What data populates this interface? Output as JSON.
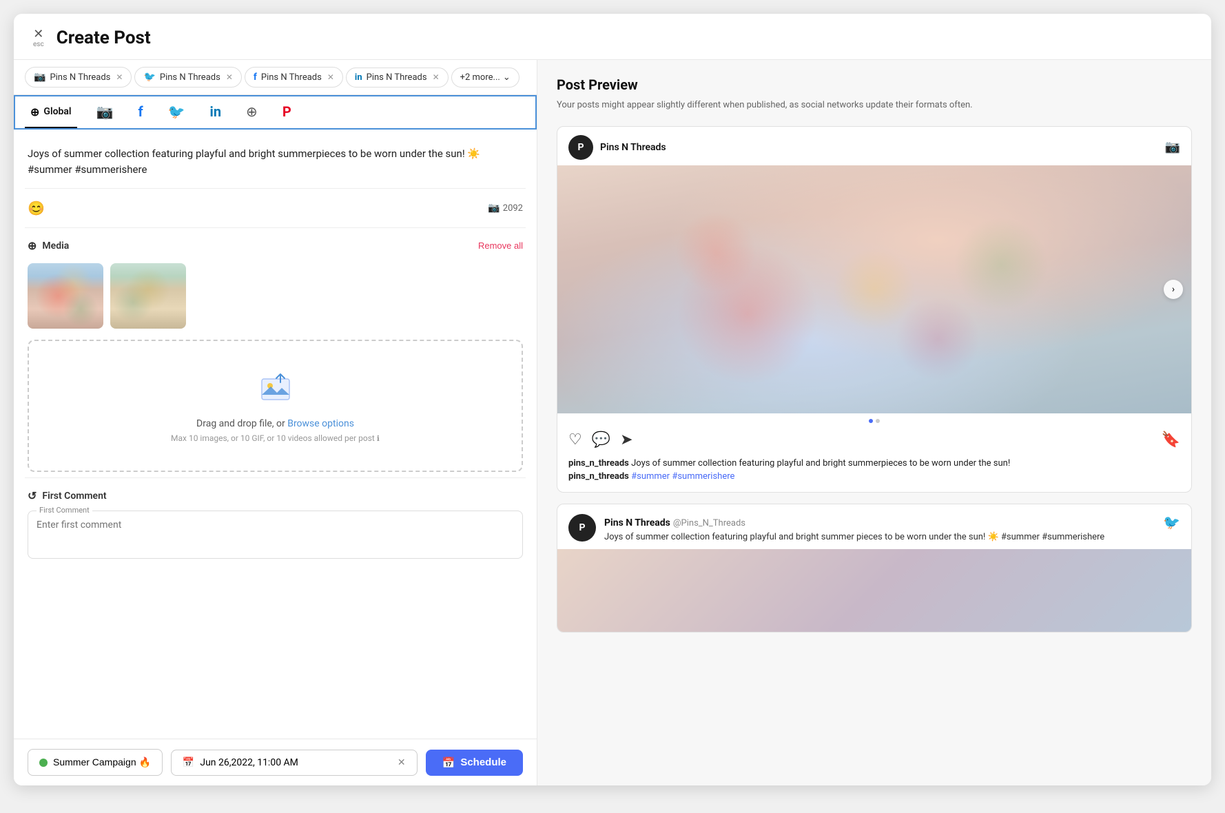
{
  "modal": {
    "title": "Create Post",
    "close_label": "×",
    "esc_label": "esc"
  },
  "tabs": [
    {
      "id": "tab-ig-1",
      "platform": "instagram",
      "label": "Pins N Threads",
      "symbol": "📷"
    },
    {
      "id": "tab-tw-1",
      "platform": "twitter",
      "label": "Pins N Threads",
      "symbol": "🐦"
    },
    {
      "id": "tab-fb-1",
      "platform": "facebook",
      "label": "Pins N Threads",
      "symbol": "f"
    },
    {
      "id": "tab-li-1",
      "platform": "linkedin",
      "label": "Pins N Threads",
      "symbol": "in"
    },
    {
      "id": "tab-more",
      "platform": "more",
      "label": "+2 more...",
      "symbol": ""
    }
  ],
  "platform_tabs": [
    {
      "id": "global",
      "label": "Global",
      "active": true
    },
    {
      "id": "instagram",
      "label": "",
      "platform": "instagram"
    },
    {
      "id": "facebook",
      "label": "",
      "platform": "facebook"
    },
    {
      "id": "twitter",
      "label": "",
      "platform": "twitter"
    },
    {
      "id": "linkedin",
      "label": "",
      "platform": "linkedin"
    },
    {
      "id": "threads",
      "label": "",
      "platform": "threads"
    },
    {
      "id": "pinterest",
      "label": "",
      "platform": "pinterest"
    }
  ],
  "post": {
    "text": "Joys of summer collection featuring playful and bright summerpieces to be worn under the sun! ☀️ #summer #summerishere",
    "char_count": "2092"
  },
  "media": {
    "label": "Media",
    "remove_all": "Remove all",
    "drop_text": "Drag and drop file, or",
    "browse_label": "Browse options",
    "drop_subtext": "Max 10 images, or 10 GIF, or 10 videos allowed per post"
  },
  "first_comment": {
    "label": "First Comment",
    "field_label": "First Comment",
    "placeholder": "Enter first comment"
  },
  "bottom_bar": {
    "campaign_label": "Summer Campaign 🔥",
    "schedule_date": "Jun 26,2022, 11:00 AM",
    "schedule_btn": "Schedule"
  },
  "preview": {
    "title": "Post Preview",
    "subtitle": "Your posts might appear slightly different when published, as social networks update their formats often.",
    "ig": {
      "username": "Pins N Threads",
      "handle": "pins_n_threads",
      "caption": "Joys of summer collection featuring playful and bright summerpieces to be worn under the sun!",
      "hashtags": "#summer #summerishere"
    },
    "twitter": {
      "username": "Pins N Threads",
      "handle": "@Pins_N_Threads",
      "text": "Joys of summer collection featuring playful and bright summer pieces to be worn under the sun! ☀️ #summer #summerishere"
    }
  },
  "icons": {
    "close": "✕",
    "emoji": "😊",
    "instagram": "📷",
    "twitter": "🐦",
    "facebook": "f",
    "linkedin": "in",
    "threads": "⊕",
    "pinterest": "P",
    "media": "⊕",
    "comment": "↺",
    "calendar": "📅",
    "heart": "♡",
    "message": "💬",
    "send": "➤",
    "bookmark": "🔖",
    "chevron_right": "›",
    "chevron_down": "⌄"
  }
}
